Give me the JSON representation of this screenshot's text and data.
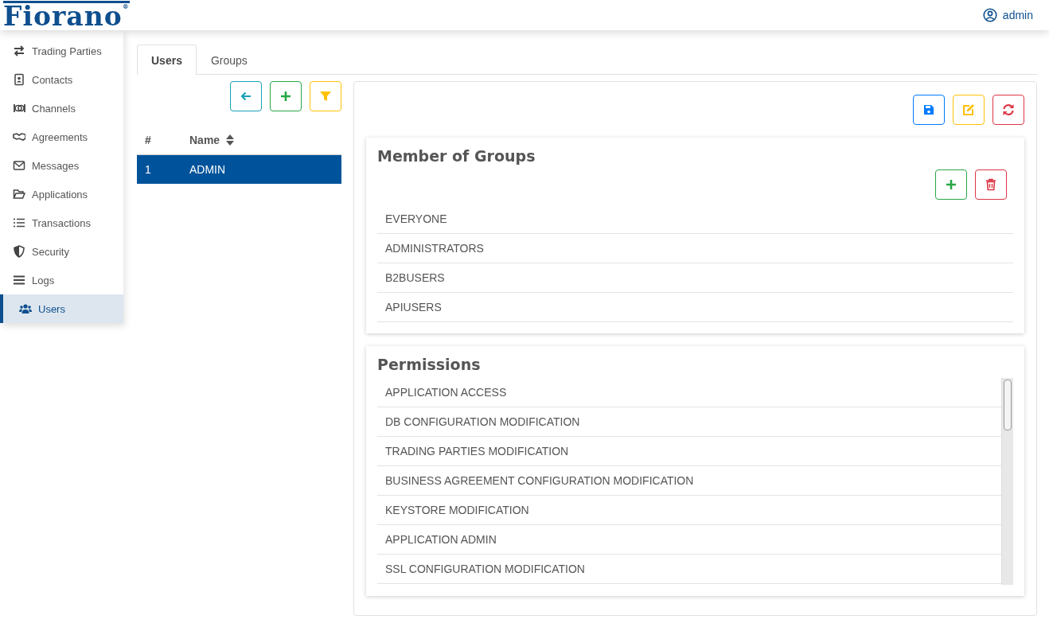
{
  "header": {
    "logo": "Fiorano$^{®}$",
    "user": "admin"
  },
  "sidebar": {
    "items": [
      {
        "label": "Trading Parties",
        "selected": false
      },
      {
        "label": "Contacts",
        "selected": false
      },
      {
        "label": "Channels",
        "selected": false
      },
      {
        "label": "Agreements",
        "selected": false
      },
      {
        "label": "Messages",
        "selected": false
      },
      {
        "label": "Applications",
        "selected": false
      },
      {
        "label": "Transactions",
        "selected": false
      },
      {
        "label": "Security",
        "selected": false
      },
      {
        "label": "Logs",
        "selected": false
      },
      {
        "label": "Users",
        "selected": true
      }
    ]
  },
  "tabs": [
    {
      "label": "Users",
      "selected": true
    },
    {
      "label": "Groups",
      "selected": false
    }
  ],
  "users_table": {
    "columns": [
      "#",
      "Name"
    ],
    "rows": [
      {
        "cells": [
          "1",
          "ADMIN"
        ],
        "selected": true
      }
    ]
  },
  "member_of_groups": {
    "title": "Member of Groups",
    "items": [
      "EVERYONE",
      "ADMINISTRATORS",
      "B2BUSERS",
      "APIUSERS"
    ]
  },
  "permissions": {
    "title": "Permissions",
    "items": [
      "APPLICATION ACCESS",
      "DB CONFIGURATION MODIFICATION",
      "TRADING PARTIES MODIFICATION",
      "BUSINESS AGREEMENT CONFIGURATION MODIFICATION",
      "KEYSTORE MODIFICATION",
      "APPLICATION ADMIN",
      "SSL CONFIGURATION MODIFICATION"
    ]
  }
}
